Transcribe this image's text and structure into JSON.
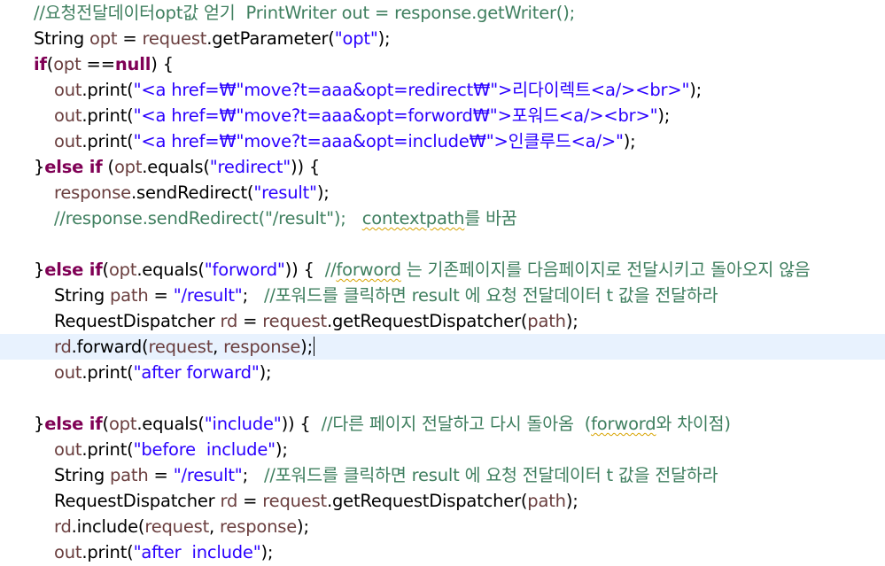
{
  "editor": {
    "lines": [
      {
        "id": 1,
        "segments": [
          {
            "t": "//요청전달데이터opt값 얻기  PrintWriter out = response.getWriter();",
            "k": "cmt"
          }
        ]
      },
      {
        "id": 2,
        "segments": [
          {
            "t": "String ",
            "k": "plain"
          },
          {
            "t": "opt",
            "k": "fld"
          },
          {
            "t": " = ",
            "k": "plain"
          },
          {
            "t": "request",
            "k": "fld"
          },
          {
            "t": ".getParameter(",
            "k": "plain"
          },
          {
            "t": "\"opt\"",
            "k": "str"
          },
          {
            "t": ");",
            "k": "plain"
          }
        ]
      },
      {
        "id": 3,
        "segments": [
          {
            "t": "if",
            "k": "kw"
          },
          {
            "t": "(",
            "k": "plain"
          },
          {
            "t": "opt",
            "k": "fld"
          },
          {
            "t": " ==",
            "k": "plain"
          },
          {
            "t": "null",
            "k": "kw"
          },
          {
            "t": ") {",
            "k": "plain"
          }
        ]
      },
      {
        "id": 4,
        "indent": 1,
        "segments": [
          {
            "t": "out",
            "k": "fld"
          },
          {
            "t": ".print(",
            "k": "plain"
          },
          {
            "t": "\"<a href=₩\"move?t=aaa&opt=redirect₩\">리다이렉트<a/><br>\"",
            "k": "str"
          },
          {
            "t": ");",
            "k": "plain"
          }
        ]
      },
      {
        "id": 5,
        "indent": 1,
        "segments": [
          {
            "t": "out",
            "k": "fld"
          },
          {
            "t": ".print(",
            "k": "plain"
          },
          {
            "t": "\"<a href=₩\"move?t=aaa&opt=forword₩\">포워드<a/><br>\"",
            "k": "str"
          },
          {
            "t": ");",
            "k": "plain"
          }
        ]
      },
      {
        "id": 6,
        "indent": 1,
        "segments": [
          {
            "t": "out",
            "k": "fld"
          },
          {
            "t": ".print(",
            "k": "plain"
          },
          {
            "t": "\"<a href=₩\"move?t=aaa&opt=include₩\">인클루드<a/>\"",
            "k": "str"
          },
          {
            "t": ");",
            "k": "plain"
          }
        ]
      },
      {
        "id": 7,
        "segments": [
          {
            "t": "}",
            "k": "plain"
          },
          {
            "t": "else if",
            "k": "kw"
          },
          {
            "t": " (",
            "k": "plain"
          },
          {
            "t": "opt",
            "k": "fld"
          },
          {
            "t": ".equals(",
            "k": "plain"
          },
          {
            "t": "\"redirect\"",
            "k": "str"
          },
          {
            "t": ")) {",
            "k": "plain"
          }
        ]
      },
      {
        "id": 8,
        "indent": 1,
        "segments": [
          {
            "t": "response",
            "k": "fld"
          },
          {
            "t": ".sendRedirect(",
            "k": "plain"
          },
          {
            "t": "\"result\"",
            "k": "str"
          },
          {
            "t": ");",
            "k": "plain"
          }
        ]
      },
      {
        "id": 9,
        "indent": 1,
        "segments": [
          {
            "t": "//response.sendRedirect(\"/result\");   ",
            "k": "cmt"
          },
          {
            "t": "contextpath",
            "k": "cmt",
            "sq": true
          },
          {
            "t": "를 바꿈",
            "k": "cmt"
          }
        ]
      },
      {
        "id": 10,
        "segments": []
      },
      {
        "id": 11,
        "segments": [
          {
            "t": "}",
            "k": "plain"
          },
          {
            "t": "else if",
            "k": "kw"
          },
          {
            "t": "(",
            "k": "plain"
          },
          {
            "t": "opt",
            "k": "fld"
          },
          {
            "t": ".equals(",
            "k": "plain"
          },
          {
            "t": "\"forword\"",
            "k": "str"
          },
          {
            "t": ")) {  ",
            "k": "plain"
          },
          {
            "t": "//",
            "k": "cmt"
          },
          {
            "t": "forword",
            "k": "cmt",
            "sq": true
          },
          {
            "t": " 는 기존페이지를 다음페이지로 전달시키고 돌아오지 않음",
            "k": "cmt"
          }
        ]
      },
      {
        "id": 12,
        "indent": 1,
        "segments": [
          {
            "t": "String ",
            "k": "plain"
          },
          {
            "t": "path",
            "k": "fld"
          },
          {
            "t": " = ",
            "k": "plain"
          },
          {
            "t": "\"/result\"",
            "k": "str"
          },
          {
            "t": ";   ",
            "k": "plain"
          },
          {
            "t": "//포워드를 클릭하면 result 에 요청 전달데이터 t 값을 전달하라",
            "k": "cmt"
          }
        ]
      },
      {
        "id": 13,
        "indent": 1,
        "segments": [
          {
            "t": "RequestDispatcher ",
            "k": "plain"
          },
          {
            "t": "rd",
            "k": "fld"
          },
          {
            "t": " = ",
            "k": "plain"
          },
          {
            "t": "request",
            "k": "fld"
          },
          {
            "t": ".getRequestDispatcher(",
            "k": "plain"
          },
          {
            "t": "path",
            "k": "fld"
          },
          {
            "t": ");",
            "k": "plain"
          }
        ]
      },
      {
        "id": 14,
        "indent": 1,
        "active": true,
        "caret": true,
        "segments": [
          {
            "t": "rd",
            "k": "fld"
          },
          {
            "t": ".forward(",
            "k": "plain"
          },
          {
            "t": "request",
            "k": "fld"
          },
          {
            "t": ", ",
            "k": "plain"
          },
          {
            "t": "response",
            "k": "fld"
          },
          {
            "t": ");",
            "k": "plain"
          }
        ]
      },
      {
        "id": 15,
        "indent": 1,
        "segments": [
          {
            "t": "out",
            "k": "fld"
          },
          {
            "t": ".print(",
            "k": "plain"
          },
          {
            "t": "\"after forward\"",
            "k": "str"
          },
          {
            "t": ");",
            "k": "plain"
          }
        ]
      },
      {
        "id": 16,
        "segments": []
      },
      {
        "id": 17,
        "segments": [
          {
            "t": "}",
            "k": "plain"
          },
          {
            "t": "else if",
            "k": "kw"
          },
          {
            "t": "(",
            "k": "plain"
          },
          {
            "t": "opt",
            "k": "fld"
          },
          {
            "t": ".equals(",
            "k": "plain"
          },
          {
            "t": "\"include\"",
            "k": "str"
          },
          {
            "t": ")) {  ",
            "k": "plain"
          },
          {
            "t": "//다른 페이지 전달하고 다시 돌아옴  (",
            "k": "cmt"
          },
          {
            "t": "forword",
            "k": "cmt",
            "sq": true
          },
          {
            "t": "와 차이점)",
            "k": "cmt"
          }
        ]
      },
      {
        "id": 18,
        "indent": 1,
        "segments": [
          {
            "t": "out",
            "k": "fld"
          },
          {
            "t": ".print(",
            "k": "plain"
          },
          {
            "t": "\"before  include\"",
            "k": "str"
          },
          {
            "t": ");",
            "k": "plain"
          }
        ]
      },
      {
        "id": 19,
        "indent": 1,
        "segments": [
          {
            "t": "String ",
            "k": "plain"
          },
          {
            "t": "path",
            "k": "fld"
          },
          {
            "t": " = ",
            "k": "plain"
          },
          {
            "t": "\"/result\"",
            "k": "str"
          },
          {
            "t": ";   ",
            "k": "plain"
          },
          {
            "t": "//포워드를 클릭하면 result 에 요청 전달데이터 t 값을 전달하라",
            "k": "cmt"
          }
        ]
      },
      {
        "id": 20,
        "indent": 1,
        "segments": [
          {
            "t": "RequestDispatcher ",
            "k": "plain"
          },
          {
            "t": "rd",
            "k": "fld"
          },
          {
            "t": " = ",
            "k": "plain"
          },
          {
            "t": "request",
            "k": "fld"
          },
          {
            "t": ".getRequestDispatcher(",
            "k": "plain"
          },
          {
            "t": "path",
            "k": "fld"
          },
          {
            "t": ");",
            "k": "plain"
          }
        ]
      },
      {
        "id": 21,
        "indent": 1,
        "segments": [
          {
            "t": "rd",
            "k": "fld"
          },
          {
            "t": ".include(",
            "k": "plain"
          },
          {
            "t": "request",
            "k": "fld"
          },
          {
            "t": ", ",
            "k": "plain"
          },
          {
            "t": "response",
            "k": "fld"
          },
          {
            "t": ");",
            "k": "plain"
          }
        ]
      },
      {
        "id": 22,
        "indent": 1,
        "segments": [
          {
            "t": "out",
            "k": "fld"
          },
          {
            "t": ".print(",
            "k": "plain"
          },
          {
            "t": "\"after  include\"",
            "k": "str"
          },
          {
            "t": ");",
            "k": "plain"
          }
        ]
      }
    ]
  },
  "colors": {
    "keyword": "#7f0055",
    "field": "#6a3e3e",
    "string": "#2a00ff",
    "comment": "#3f7f5f",
    "active_line": "#e8f2fe",
    "spell_squiggle": "#d7a300"
  }
}
